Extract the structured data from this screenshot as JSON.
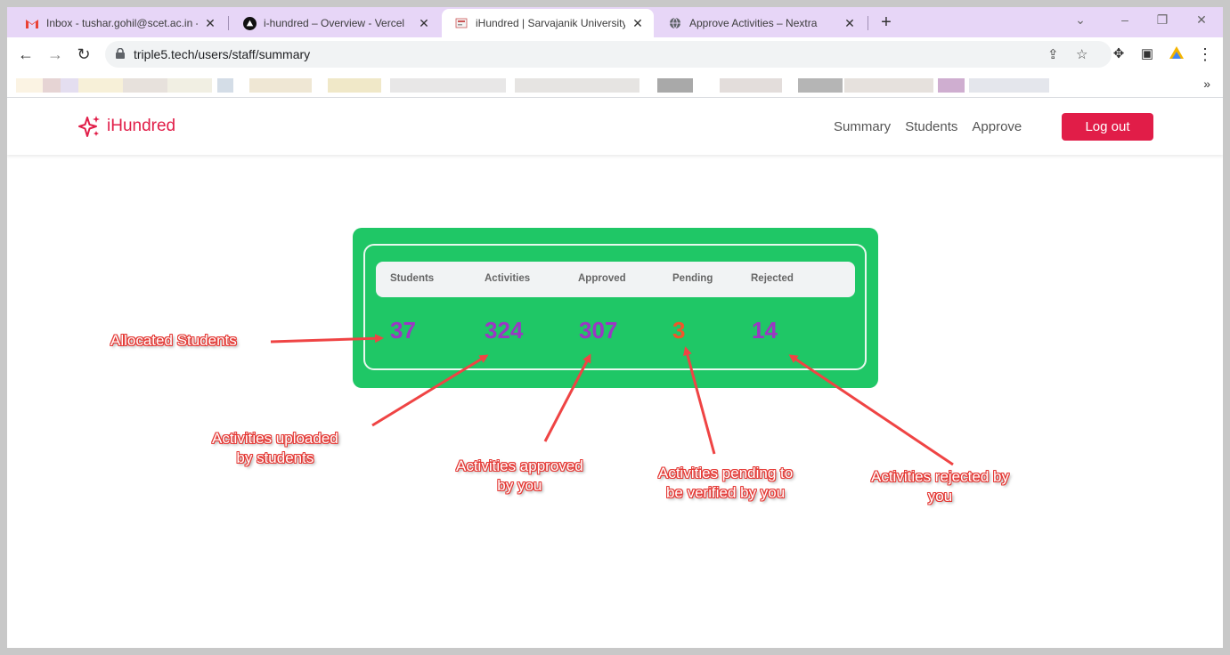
{
  "browser": {
    "tabs": [
      {
        "title": "Inbox - tushar.gohil@scet.ac.in -"
      },
      {
        "title": "i-hundred – Overview - Vercel"
      },
      {
        "title": "iHundred | Sarvajanik University"
      },
      {
        "title": "Approve Activities – Nextra"
      }
    ],
    "url": "triple5.tech/users/staff/summary",
    "bookmarks_more": "»"
  },
  "site": {
    "logo_text": "iHundred",
    "nav": {
      "summary": "Summary",
      "students": "Students",
      "approve": "Approve"
    },
    "logout_label": "Log out"
  },
  "summary": {
    "headers": {
      "students": "Students",
      "activities": "Activities",
      "approved": "Approved",
      "pending": "Pending",
      "rejected": "Rejected"
    },
    "values": {
      "students": "37",
      "activities": "324",
      "approved": "307",
      "pending": "3",
      "rejected": "14"
    }
  },
  "annotations": {
    "allocated": "Allocated Students",
    "uploaded_1": "Activities uploaded",
    "uploaded_2": "by students",
    "approved_1": "Activities approved",
    "approved_2": "by you",
    "pending_1": "Activities pending to",
    "pending_2": "be verified by you",
    "rejected_1": "Activities rejected by",
    "rejected_2": "you"
  },
  "colors": {
    "accent": "#e11d48",
    "card": "#1fc766",
    "value": "#9b37c4",
    "pending": "#f0562a",
    "annotation": "#e53935"
  }
}
